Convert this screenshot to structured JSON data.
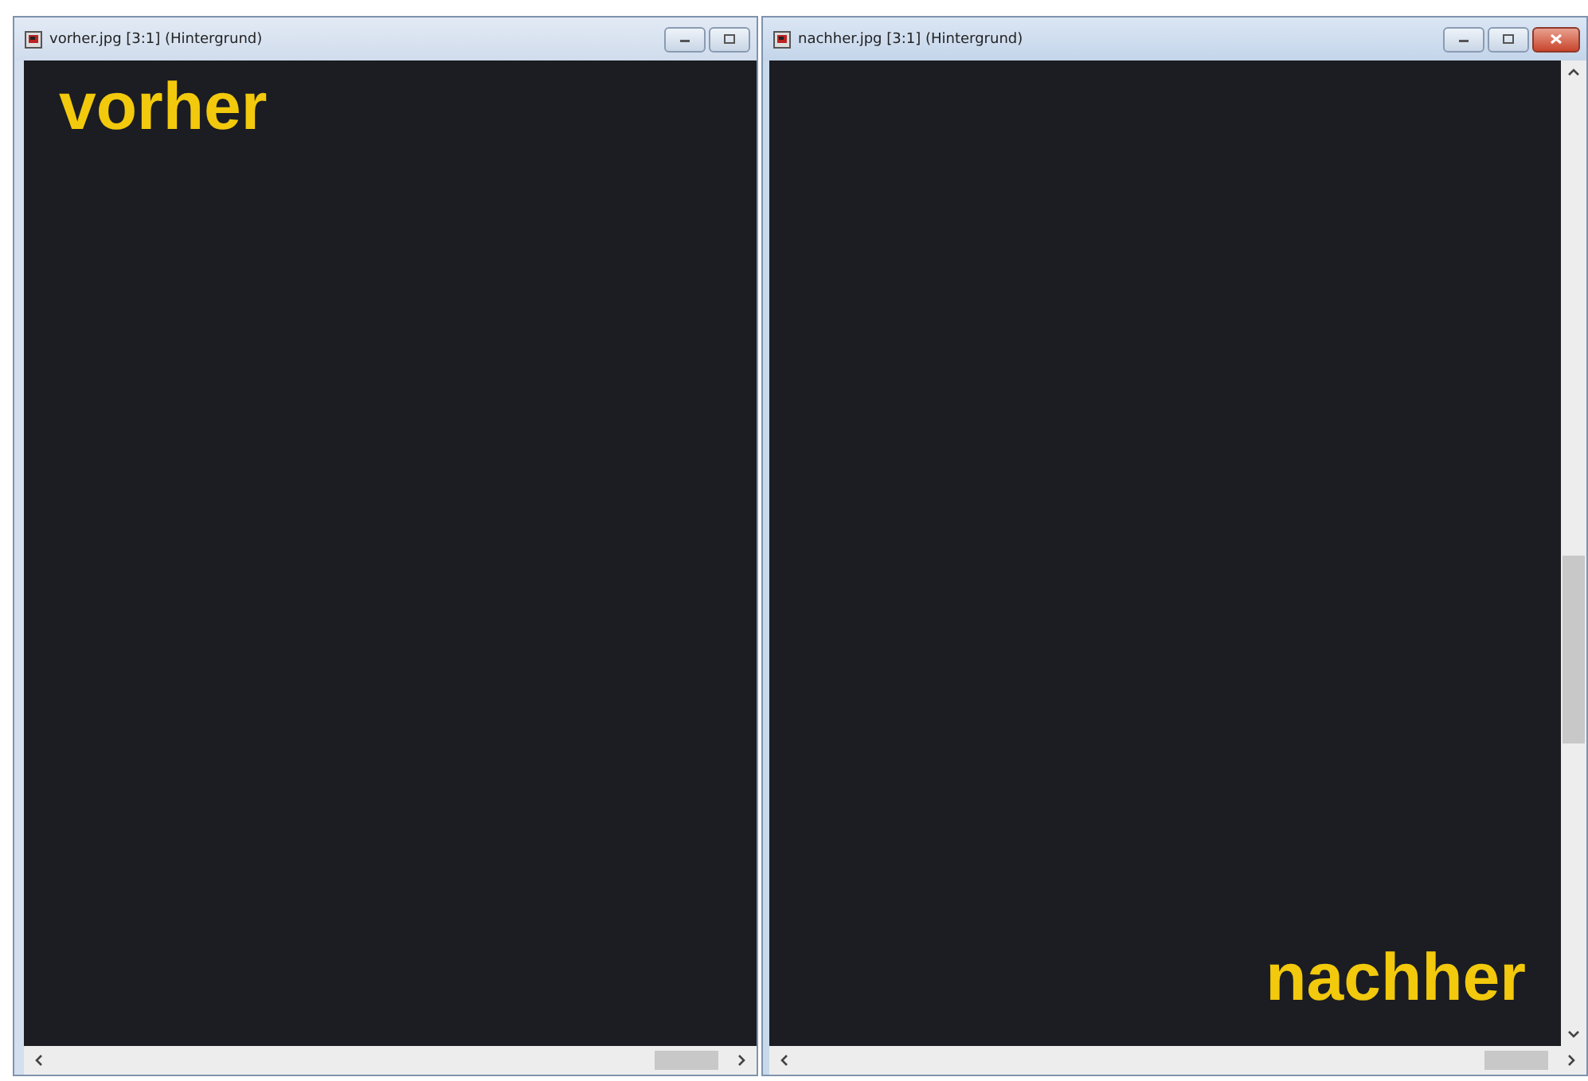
{
  "windows": [
    {
      "title": "vorher.jpg [3:1] (Hintergrund)",
      "active": false,
      "canvas_label": "vorher",
      "label_at_bottom_right": false,
      "vertical_scrollbar": false,
      "close_button": false
    },
    {
      "title": "nachher.jpg [3:1] (Hintergrund)",
      "active": true,
      "canvas_label": "nachher",
      "label_at_bottom_right": true,
      "vertical_scrollbar": true,
      "close_button": true
    }
  ]
}
